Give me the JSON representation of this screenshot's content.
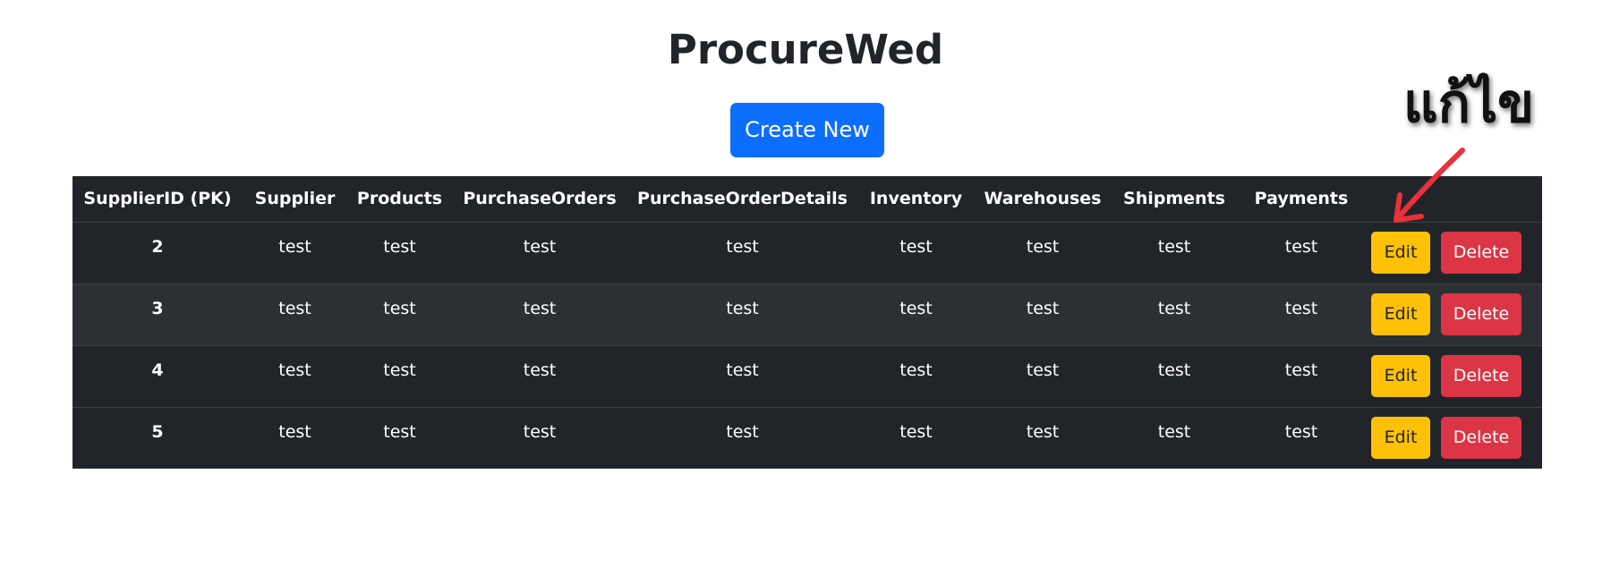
{
  "page": {
    "title": "ProcureWed",
    "create_button_label": "Create New"
  },
  "table": {
    "headers": [
      "SupplierID (PK)",
      "Supplier",
      "Products",
      "PurchaseOrders",
      "PurchaseOrderDetails",
      "Inventory",
      "Warehouses",
      "Shipments",
      "Payments",
      ""
    ],
    "rows": [
      {
        "id": "2",
        "cells": [
          "test",
          "test",
          "test",
          "test",
          "test",
          "test",
          "test",
          "test"
        ],
        "edit_label": "Edit",
        "delete_label": "Delete"
      },
      {
        "id": "3",
        "cells": [
          "test",
          "test",
          "test",
          "test",
          "test",
          "test",
          "test",
          "test"
        ],
        "edit_label": "Edit",
        "delete_label": "Delete"
      },
      {
        "id": "4",
        "cells": [
          "test",
          "test",
          "test",
          "test",
          "test",
          "test",
          "test",
          "test"
        ],
        "edit_label": "Edit",
        "delete_label": "Delete"
      },
      {
        "id": "5",
        "cells": [
          "test",
          "test",
          "test",
          "test",
          "test",
          "test",
          "test",
          "test"
        ],
        "edit_label": "Edit",
        "delete_label": "Delete"
      }
    ]
  },
  "annotation": {
    "text": "แก้ไข",
    "arrow_color": "#e8313a"
  },
  "colors": {
    "primary": "#0d6efd",
    "warning": "#ffc107",
    "danger": "#dc3545",
    "table_dark": "#212529",
    "table_stripe": "#2c3034"
  }
}
